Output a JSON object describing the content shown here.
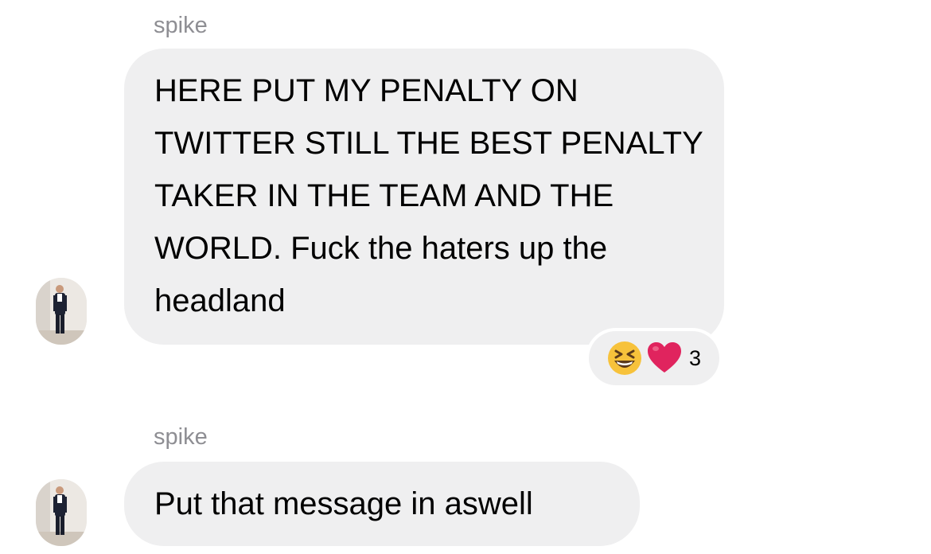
{
  "messages": [
    {
      "sender": "spike",
      "text": "HERE PUT MY PENALTY ON TWITTER STILL THE BEST PENALTY TAKER IN THE TEAM AND THE WORLD. Fuck the haters up the headland",
      "reactions": {
        "icons": [
          "grinning-squinting-face-icon",
          "red-heart-icon"
        ],
        "count": "3"
      }
    },
    {
      "sender": "spike",
      "text": "Put that message in aswell"
    }
  ],
  "colors": {
    "bubble": "#efeff0",
    "sender_name": "#8e8e93",
    "background": "#ffffff",
    "heart": "#e0245e",
    "emoji_face": "#f7c23b"
  }
}
